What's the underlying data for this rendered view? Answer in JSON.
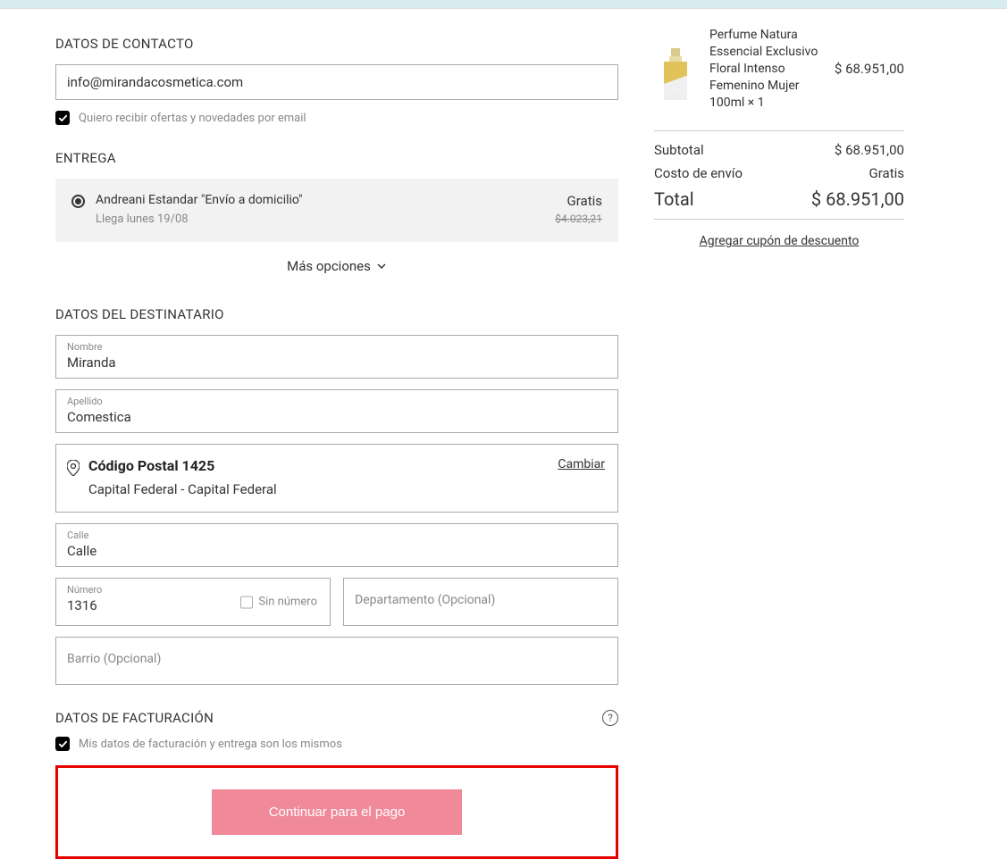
{
  "contact": {
    "heading": "DATOS DE CONTACTO",
    "email": "info@mirandacosmetica.com",
    "offers_label": "Quiero recibir ofertas y novedades por email"
  },
  "shipping": {
    "heading": "ENTREGA",
    "option_title": "Andreani Estandar \"Envío a domicilio\"",
    "option_sub": "Llega lunes 19/08",
    "price_free": "Gratis",
    "price_old": "$4.023,21",
    "more_options": "Más opciones"
  },
  "recipient": {
    "heading": "DATOS DEL DESTINATARIO",
    "name_label": "Nombre",
    "name_value": "Miranda",
    "lastname_label": "Apellido",
    "lastname_value": "Comestica",
    "postal_title": "Código Postal 1425",
    "postal_sub": "Capital Federal - Capital Federal",
    "change": "Cambiar",
    "street_label": "Calle",
    "street_value": "Calle",
    "number_label": "Número",
    "number_value": "1316",
    "no_number": "Sin número",
    "dept_placeholder": "Departamento (Opcional)",
    "barrio_placeholder": "Barrio (Opcional)"
  },
  "billing": {
    "heading": "DATOS DE FACTURACIÓN",
    "same_label": "Mis datos de facturación y entrega son los mismos"
  },
  "cta": {
    "continue": "Continuar para el pago"
  },
  "summary": {
    "product_name": "Perfume Natura Essencial Exclusivo Floral Intenso Femenino Mujer 100ml × 1",
    "product_price": "$ 68.951,00",
    "subtotal_label": "Subtotal",
    "subtotal_value": "$ 68.951,00",
    "shipping_label": "Costo de envío",
    "shipping_value": "Gratis",
    "total_label": "Total",
    "total_value": "$ 68.951,00",
    "coupon": "Agregar cupón de descuento"
  }
}
